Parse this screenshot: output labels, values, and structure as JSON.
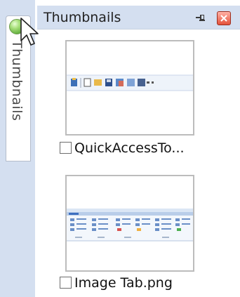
{
  "side_tab": {
    "label": "Thumbnails"
  },
  "panel": {
    "title": "Thumbnails",
    "pin_icon": "pin-icon",
    "close_icon": "close-icon"
  },
  "items": [
    {
      "label": "QuickAccessTo...",
      "checked": false,
      "preview": "quick-access-toolbar-preview"
    },
    {
      "label": "Image Tab.png",
      "checked": false,
      "preview": "ribbon-image-tab-preview"
    }
  ],
  "colors": {
    "strip_bg": "#d4dff0",
    "header_bg": "#d4dff0",
    "close_red": "#e4513a",
    "thumb_border": "#bcbcbc"
  }
}
